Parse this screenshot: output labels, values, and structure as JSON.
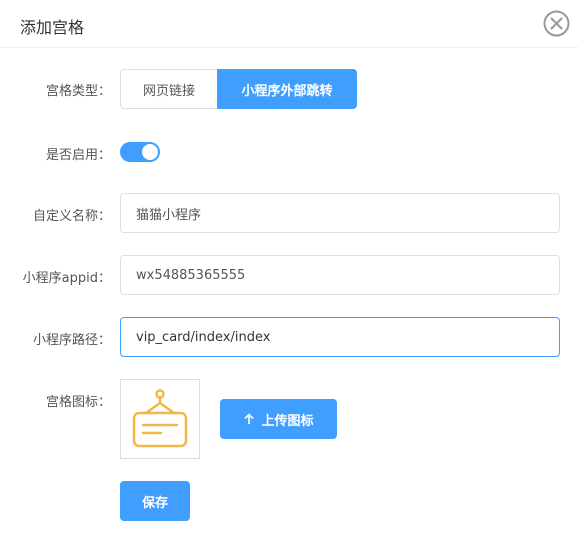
{
  "dialog": {
    "title": "添加宫格"
  },
  "form": {
    "type": {
      "label": "宫格类型：",
      "options": [
        "网页链接",
        "小程序外部跳转"
      ],
      "selected": "小程序外部跳转"
    },
    "enabled": {
      "label": "是否启用：",
      "value": true
    },
    "name": {
      "label": "自定义名称：",
      "value": "猫猫小程序"
    },
    "appid": {
      "label": "小程序appid：",
      "value": "wx54885365555"
    },
    "path": {
      "label": "小程序路径：",
      "value": "vip_card/index/index"
    },
    "icon": {
      "label": "宫格图标：",
      "icon_name": "hanging-sign-icon",
      "icon_color": "#f0b848",
      "upload_label": "上传图标"
    },
    "save_label": "保存"
  },
  "colors": {
    "primary": "#409eff",
    "border": "#dcdfe6"
  }
}
